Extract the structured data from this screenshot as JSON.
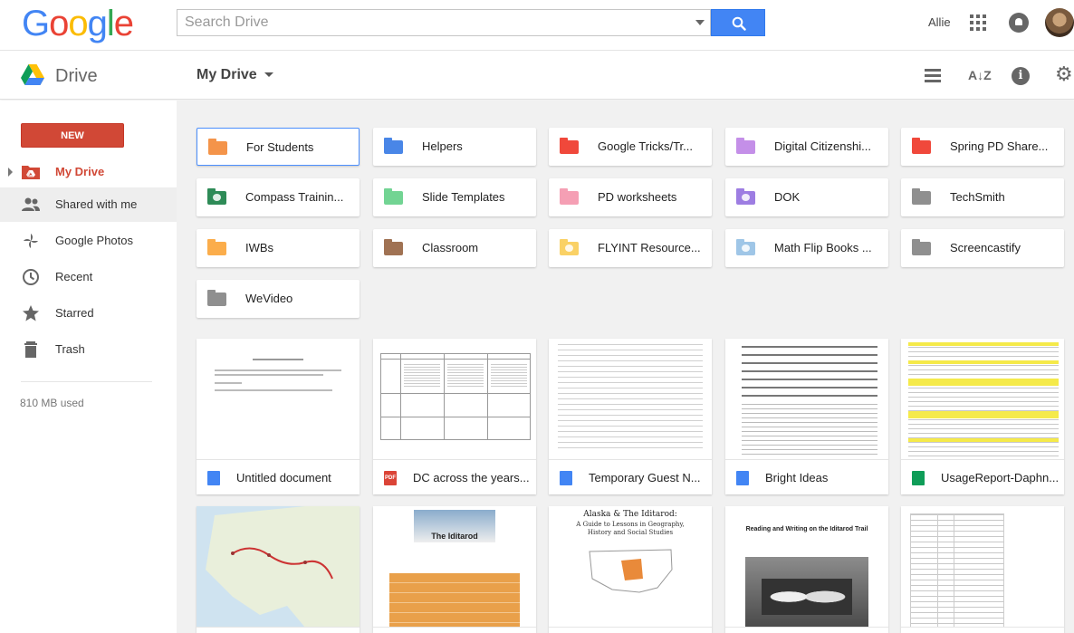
{
  "header": {
    "logo_letters": [
      {
        "ch": "G",
        "color": "#4285f4"
      },
      {
        "ch": "o",
        "color": "#ea4335"
      },
      {
        "ch": "o",
        "color": "#fbbc05"
      },
      {
        "ch": "g",
        "color": "#4285f4"
      },
      {
        "ch": "l",
        "color": "#34a853"
      },
      {
        "ch": "e",
        "color": "#ea4335"
      }
    ],
    "search_placeholder": "Search Drive",
    "user_name": "Allie"
  },
  "subbar": {
    "app_title": "Drive",
    "location": "My Drive"
  },
  "sidebar": {
    "new_label": "NEW",
    "items": [
      {
        "label": "My Drive",
        "icon": "drive-folder-icon"
      },
      {
        "label": "Shared with me",
        "icon": "people-icon"
      },
      {
        "label": "Google Photos",
        "icon": "photos-pinwheel-icon"
      },
      {
        "label": "Recent",
        "icon": "clock-icon"
      },
      {
        "label": "Starred",
        "icon": "star-icon"
      },
      {
        "label": "Trash",
        "icon": "trash-icon"
      }
    ],
    "storage": "810 MB used"
  },
  "folders": [
    {
      "name": "For Students",
      "color": "#f4944a",
      "shared": false
    },
    {
      "name": "Helpers",
      "color": "#4986e7",
      "shared": false
    },
    {
      "name": "Google Tricks/Tr...",
      "color": "#f0483b",
      "shared": false
    },
    {
      "name": "Digital Citizenshi...",
      "color": "#c48fe8",
      "shared": false
    },
    {
      "name": "Spring PD Share...",
      "color": "#f0483b",
      "shared": false
    },
    {
      "name": "Compass Trainin...",
      "color": "#2e8b57",
      "shared": true
    },
    {
      "name": "Slide Templates",
      "color": "#72d493",
      "shared": false
    },
    {
      "name": "PD worksheets",
      "color": "#f59fb4",
      "shared": false
    },
    {
      "name": "DOK",
      "color": "#9d7de2",
      "shared": true
    },
    {
      "name": "TechSmith",
      "color": "#8f8f8f",
      "shared": false
    },
    {
      "name": "IWBs",
      "color": "#fbad4b",
      "shared": false
    },
    {
      "name": "Classroom",
      "color": "#a07253",
      "shared": false
    },
    {
      "name": "FLYINT Resource...",
      "color": "#fad165",
      "shared": true
    },
    {
      "name": "Math Flip Books ...",
      "color": "#9fc6e7",
      "shared": true
    },
    {
      "name": "Screencastify",
      "color": "#8f8f8f",
      "shared": false
    },
    {
      "name": "WeVideo",
      "color": "#8f8f8f",
      "shared": false
    }
  ],
  "files": [
    {
      "name": "Untitled document",
      "type": "doc",
      "type_color": "#4285f4"
    },
    {
      "name": "DC across the years...",
      "type": "PDF",
      "type_color": "#db4437"
    },
    {
      "name": "Temporary Guest N...",
      "type": "doc",
      "type_color": "#4285f4"
    },
    {
      "name": "Bright Ideas",
      "type": "doc",
      "type_color": "#4285f4"
    },
    {
      "name": "UsageReport-Daphn...",
      "type": "sheet",
      "type_color": "#0f9d58"
    }
  ],
  "thumbnails_row2": {
    "iditarod_title": "The Iditarod",
    "alaska_title": "Alaska & The Iditarod:",
    "alaska_sub": "A Guide to Lessons in Geography, History and Social Studies",
    "reading_title": "Reading and Writing on the Iditarod Trail"
  }
}
